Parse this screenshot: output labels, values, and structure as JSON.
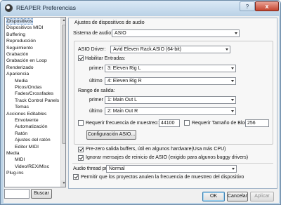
{
  "window": {
    "title": "REAPER Preferencias",
    "help_label": "?",
    "close_label": "x"
  },
  "tree": {
    "items": [
      {
        "label": "Dispositivos",
        "level": "cat"
      },
      {
        "label": "Dispositivos MIDI",
        "level": "cat"
      },
      {
        "label": "Buffering",
        "level": "cat"
      },
      {
        "label": "Reproducción",
        "level": "cat"
      },
      {
        "label": "Seguimiento",
        "level": "cat"
      },
      {
        "label": "Grabación",
        "level": "cat"
      },
      {
        "label": "Grabación en Loop",
        "level": "cat"
      },
      {
        "label": "Renderizado",
        "level": "cat"
      },
      {
        "label": "Apariencia",
        "level": "cat"
      },
      {
        "label": "Media",
        "level": "sub"
      },
      {
        "label": "Picos/Ondas",
        "level": "sub"
      },
      {
        "label": "Fades/Crossfades",
        "level": "sub"
      },
      {
        "label": "Track Control Panels",
        "level": "sub"
      },
      {
        "label": "Temas",
        "level": "sub"
      },
      {
        "label": "Acciones Editables",
        "level": "cat"
      },
      {
        "label": "Envolvente",
        "level": "sub"
      },
      {
        "label": "Automatización",
        "level": "sub"
      },
      {
        "label": "Ratón",
        "level": "sub"
      },
      {
        "label": "Ajustes del ratón",
        "level": "sub"
      },
      {
        "label": "Editor MIDI",
        "level": "sub"
      },
      {
        "label": "Media",
        "level": "cat"
      },
      {
        "label": "MIDI",
        "level": "sub"
      },
      {
        "label": "Video/REX/Misc",
        "level": "sub"
      },
      {
        "label": "Plug-ins",
        "level": "cat"
      }
    ],
    "selected": "Dispositivos"
  },
  "search": {
    "value": "",
    "button_label": "Buscar"
  },
  "audio": {
    "heading": "Ajustes de dispositivos de audio",
    "system_label": "Sistema de audio:",
    "system_value": "ASIO",
    "driver_label": "ASIO Driver:",
    "driver_value": "Avid Eleven Rack ASIO (64-bit)",
    "enable_inputs_label": "Habilitar Entradas:",
    "enable_inputs_checked": true,
    "inputs_first_label": "primer",
    "inputs_first_value": "3: Eleven Rig L",
    "inputs_last_label": "último",
    "inputs_last_value": "4: Eleven Rig R",
    "outputs_heading": "Rango de salida:",
    "outputs_first_label": "primer",
    "outputs_first_value": "1: Main Out L",
    "outputs_last_label": "último",
    "outputs_last_value": "2: Main Out R",
    "samplerate_label": "Requerir frecuencia de muestreo:",
    "samplerate_checked": false,
    "samplerate_value": "44100",
    "blocksize_label": "Requerir Tamaño de Bloque:",
    "blocksize_checked": false,
    "blocksize_value": "256",
    "asio_config_label": "Configuración ASIO...",
    "prezero_label": "Pre-zero salida buffers, útil en algunos hardware(Usa más CPU)",
    "prezero_checked": true,
    "ignore_reset_label": "Ignorar mensajes de reinicio de ASIO (exigido para algunos buggy drivers)",
    "ignore_reset_checked": true,
    "thread_priority_label": "Audio thread priority:",
    "thread_priority_value": "Normal",
    "allow_projects_label": "Permitir que los proyectos anulen la frecuencia de muestreo del dispositivo",
    "allow_projects_checked": true
  },
  "footer": {
    "ok_label": "OK",
    "cancel_label": "Cancelar",
    "apply_label": "Aplicar"
  },
  "colors": {
    "accent": "#3c7fb1",
    "window_frame": "#bcd3e6",
    "close_button": "#c5442e"
  }
}
